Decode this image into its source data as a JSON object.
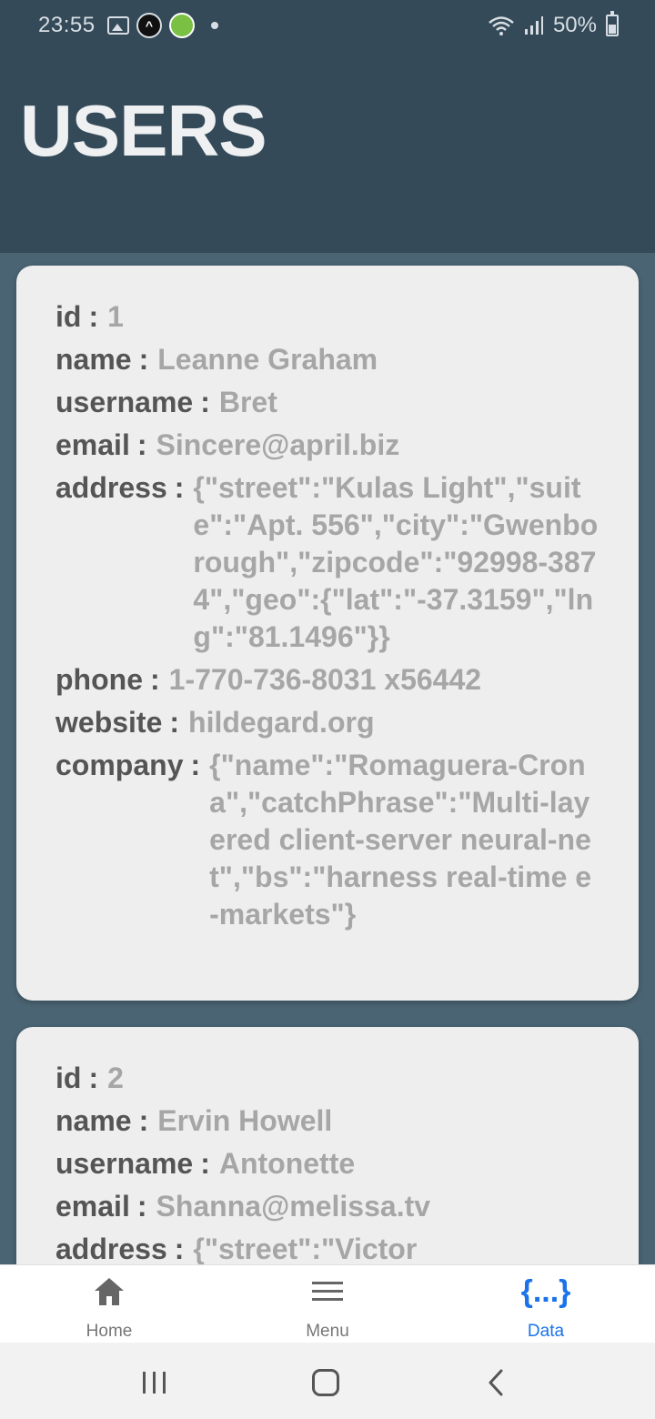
{
  "status_bar": {
    "time": "23:55",
    "battery": "50%",
    "icons": [
      "image-icon",
      "app-circle-icon",
      "home-app-icon",
      "notification-dot-icon",
      "wifi-icon",
      "signal-icon",
      "battery-icon"
    ]
  },
  "header": {
    "title": "USERS"
  },
  "users": [
    {
      "id": {
        "key": "id",
        "value": "1"
      },
      "name": {
        "key": "name",
        "value": "Leanne Graham"
      },
      "username": {
        "key": "username",
        "value": "Bret"
      },
      "email": {
        "key": "email",
        "value": "Sincere@april.biz"
      },
      "address": {
        "key": "address",
        "value": "{\"street\":\"Kulas Light\",\"suite\":\"Apt. 556\",\"city\":\"Gwenborough\",\"zipcode\":\"92998-3874\",\"geo\":{\"lat\":\"-37.3159\",\"lng\":\"81.1496\"}}"
      },
      "phone": {
        "key": "phone",
        "value": "1-770-736-8031 x56442"
      },
      "website": {
        "key": "website",
        "value": "hildegard.org"
      },
      "company": {
        "key": "company",
        "value": "{\"name\":\"Romaguera-Crona\",\"catchPhrase\":\"Multi-layered client-server neural-net\",\"bs\":\"harness real-time e-markets\"}"
      }
    },
    {
      "id": {
        "key": "id",
        "value": "2"
      },
      "name": {
        "key": "name",
        "value": "Ervin Howell"
      },
      "username": {
        "key": "username",
        "value": "Antonette"
      },
      "email": {
        "key": "email",
        "value": "Shanna@melissa.tv"
      },
      "address": {
        "key": "address",
        "value": "{\"street\":\"Victor"
      }
    }
  ],
  "separator": ":",
  "bottom_nav": {
    "items": [
      {
        "label": "Home",
        "icon": "home-icon"
      },
      {
        "label": "Menu",
        "icon": "menu-icon"
      },
      {
        "label": "Data",
        "icon": "data-braces-icon",
        "glyph": "{...}",
        "active": true
      }
    ]
  },
  "colors": {
    "header_bg": "#344a59",
    "page_bg": "#4a6473",
    "card_bg": "#eeeeee",
    "accent": "#1a73e8"
  }
}
